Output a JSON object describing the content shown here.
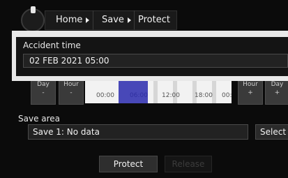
{
  "breadcrumb": {
    "home": "Home",
    "save": "Save",
    "protect": "Protect"
  },
  "accident": {
    "label": "Accident time",
    "value": "02 FEB 2021 05:00"
  },
  "timeline": {
    "left_buttons": [
      {
        "label": "Day",
        "sign": "-"
      },
      {
        "label": "Hour",
        "sign": "-"
      }
    ],
    "right_buttons": [
      {
        "label": "Hour",
        "sign": "+"
      },
      {
        "label": "Day",
        "sign": "+"
      }
    ],
    "ticks": [
      "00:00",
      "06:00",
      "12:00",
      "18:00",
      "00:"
    ]
  },
  "save_area": {
    "label": "Save area",
    "value": "Save 1: No data",
    "select_label": "Select"
  },
  "actions": {
    "protect_label": "Protect",
    "release_label": "Release"
  }
}
